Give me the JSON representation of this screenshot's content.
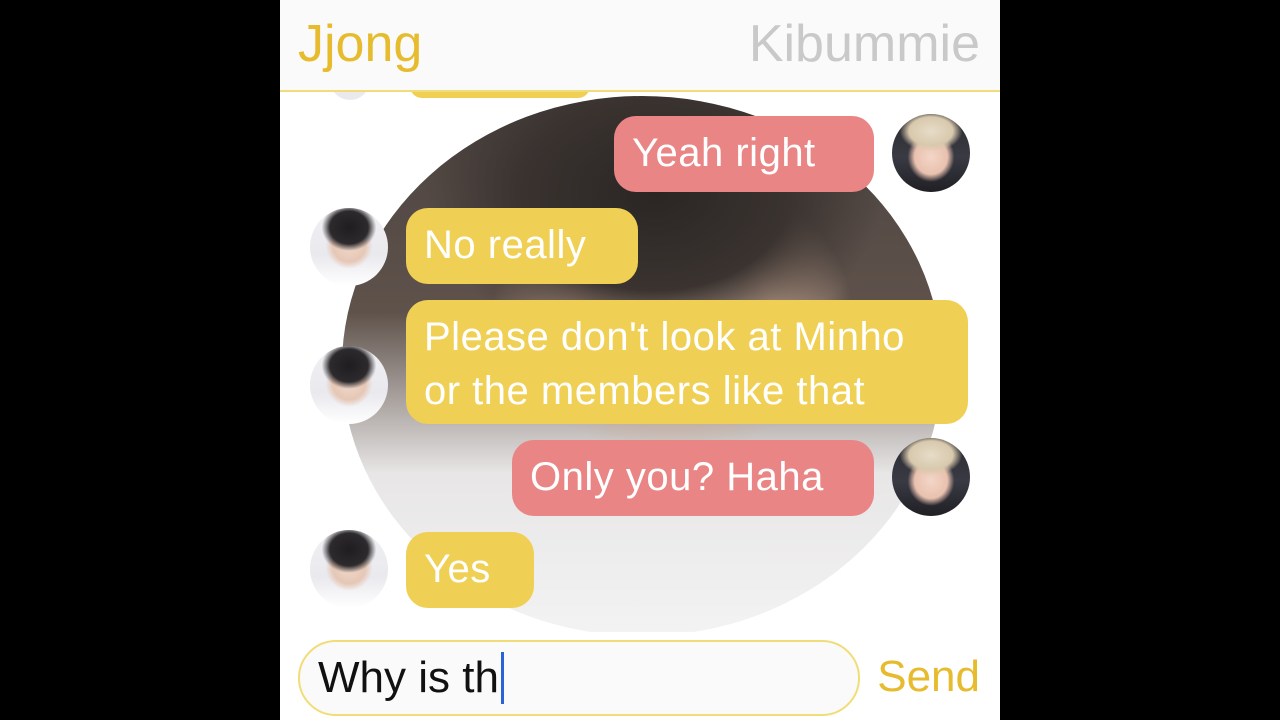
{
  "header": {
    "contact_left": "Jjong",
    "contact_right": "Kibummie"
  },
  "messages": [
    {
      "from": "Kibummie",
      "side": "right",
      "text": "Yeah right",
      "avatar": "kibum-avatar"
    },
    {
      "from": "Jjong",
      "side": "left",
      "text": "No really",
      "avatar": "jong-avatar"
    },
    {
      "from": "Jjong",
      "side": "left",
      "lines": [
        "Please don't look at Minho",
        "or the members like that"
      ],
      "avatar": "jong-avatar"
    },
    {
      "from": "Kibummie",
      "side": "right",
      "text": "Only you? Haha",
      "avatar": "kibum-avatar"
    },
    {
      "from": "Jjong",
      "side": "left",
      "text": "Yes",
      "avatar": "jong-avatar"
    }
  ],
  "composer": {
    "input_value": "Why is th",
    "send_label": "Send"
  },
  "colors": {
    "accent_yellow": "#efd054",
    "header_yellow": "#e7bb2e",
    "sent_pink": "#e98585",
    "muted_gray": "#c9c9c9",
    "caret_blue": "#2a63d8"
  }
}
